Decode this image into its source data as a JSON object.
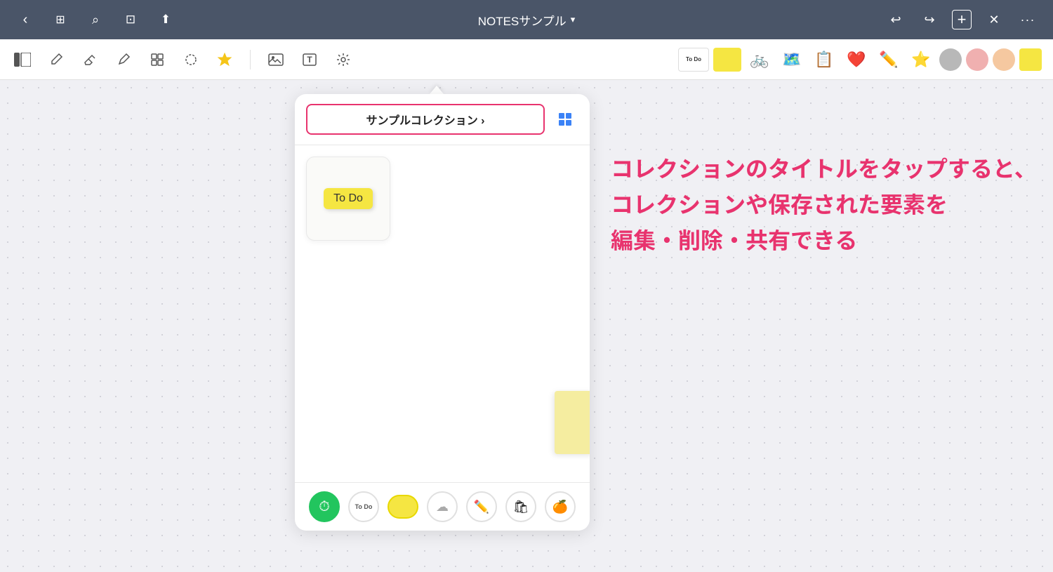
{
  "app": {
    "title": "NOTESサンプル",
    "title_chevron": "›"
  },
  "nav": {
    "back": "‹",
    "forward": "›",
    "grid_icon": "⊞",
    "search_icon": "⌕",
    "bookmark_icon": "⊡",
    "share_icon": "⬆",
    "add_icon": "+",
    "close_icon": "✕",
    "more_icon": "···",
    "undo_icon": "↩",
    "redo_icon": "↪"
  },
  "toolbar": {
    "panel_icon": "▣",
    "pencil_icon": "✏",
    "eraser_icon": "◇",
    "marker_icon": "✒",
    "shapes_icon": "❒",
    "lasso_icon": "○",
    "stamp_icon": "★",
    "image_icon": "⊞",
    "text_icon": "T",
    "tool_icon": "⚙"
  },
  "stickers": {
    "todo_label": "To Do",
    "todo_bg": "#f5e642",
    "items": [
      "🚲",
      "🗺",
      "📋",
      "❤",
      "✏",
      "⭐",
      "○",
      "○",
      "○",
      "🟡"
    ]
  },
  "collection": {
    "title": "サンプルコレクション ›",
    "title_border_color": "#e8336e"
  },
  "todo_card": {
    "label": "To Do"
  },
  "annotation": {
    "line1": "コレクションのタイトルをタップすると、",
    "line2": "コレクションや保存された要素を",
    "line3": "編集・削除・共有できる"
  },
  "footer_buttons": {
    "clock": "⏱",
    "todo": "To Do",
    "yellow": "",
    "cloud": "☁",
    "pen": "✏",
    "bag": "🛍",
    "orange": "🍊"
  }
}
